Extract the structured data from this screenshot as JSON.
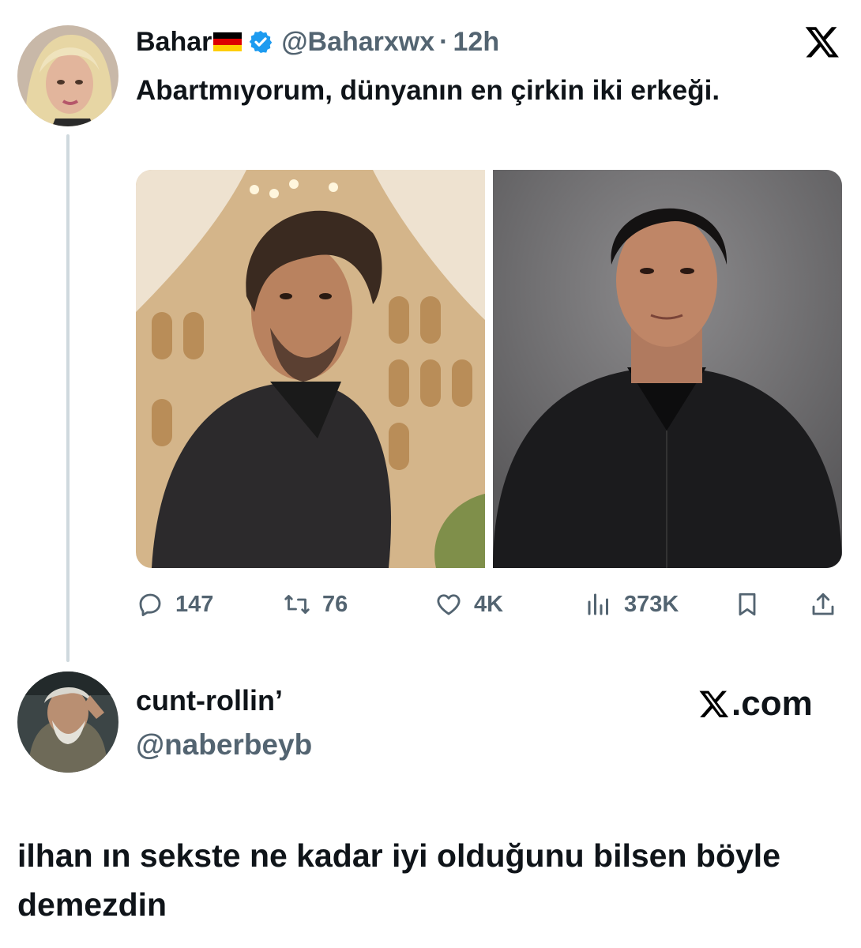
{
  "tweet": {
    "author_name": "Bahar",
    "author_handle": "@Baharxwx",
    "separator": "·",
    "time": "12h",
    "text": "Abartmıyorum, dünyanın en çirkin iki erkeği.",
    "flag_icon": "germany-flag-icon",
    "verified": true,
    "accent_color": "#1d9bf0",
    "metrics": {
      "replies": "147",
      "retweets": "76",
      "likes": "4K",
      "views": "373K"
    }
  },
  "reply_account": {
    "name": "cunt-rollin’",
    "handle": "@naberbeyb",
    "brand": ".com"
  },
  "reply_text": "ilhan ın sekste ne kadar iyi olduğunu bilsen böyle demezdin"
}
